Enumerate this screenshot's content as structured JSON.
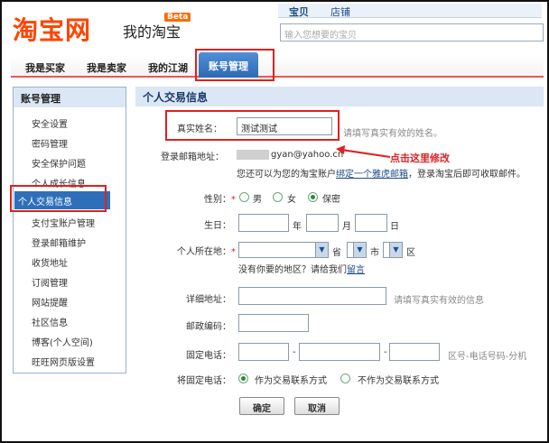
{
  "header": {
    "logo": "淘宝网",
    "logo_sub": "我的淘宝",
    "beta": "Beta",
    "search_tabs": [
      "宝贝",
      "店铺"
    ],
    "search_placeholder": "输入您想要的宝贝"
  },
  "nav": {
    "items": [
      "我是买家",
      "我是卖家",
      "我的江湖"
    ],
    "active": "账号管理"
  },
  "sidebar": {
    "title": "账号管理",
    "items": [
      "安全设置",
      "密码管理",
      "安全保护问题",
      "个人成长信息",
      "个人交易信息",
      "支付宝账户管理",
      "登录邮箱维护",
      "收货地址",
      "订阅管理",
      "网站提醒",
      "社区信息",
      "博客(个人空间)",
      "旺旺网页版设置"
    ],
    "active_index": 4
  },
  "form": {
    "title": "个人交易信息",
    "real_name": {
      "label": "真实姓名：",
      "value": "测试测试",
      "hint": "请填写真实有效的姓名。"
    },
    "email": {
      "label": "登录邮箱地址：",
      "value": "gyan@yahoo.cn",
      "desc_pre": "您还可以为您的淘宝账户",
      "desc_link": "绑定一个雅虎邮箱",
      "desc_post": "，登录淘宝后即可收取邮件。"
    },
    "annotation": "点击这里修改",
    "gender": {
      "label": "性别：",
      "options": [
        "男",
        "女",
        "保密"
      ],
      "selected": 2
    },
    "birthday": {
      "label": "生日：",
      "year": "年",
      "month": "月",
      "day": "日"
    },
    "location": {
      "label": "个人所在地：",
      "province": "省",
      "city": "市",
      "district": "区",
      "note_pre": "没有你要的地区？请给我们",
      "note_link": "留言"
    },
    "address": {
      "label": "详细地址：",
      "hint": "请填写真实有效的信息"
    },
    "zip": {
      "label": "邮政编码："
    },
    "phone": {
      "label": "固定电话：",
      "sep": "-",
      "hint": "区号-电话号码-分机"
    },
    "phone_as": {
      "label": "将固定电话：",
      "options": [
        "作为交易联系方式",
        "不作为交易联系方式"
      ],
      "selected": 0
    },
    "confirm": "确定",
    "cancel": "取消"
  },
  "colors": {
    "brand": "#ff4400",
    "accent": "#2f6fba",
    "highlight": "#e02020"
  }
}
